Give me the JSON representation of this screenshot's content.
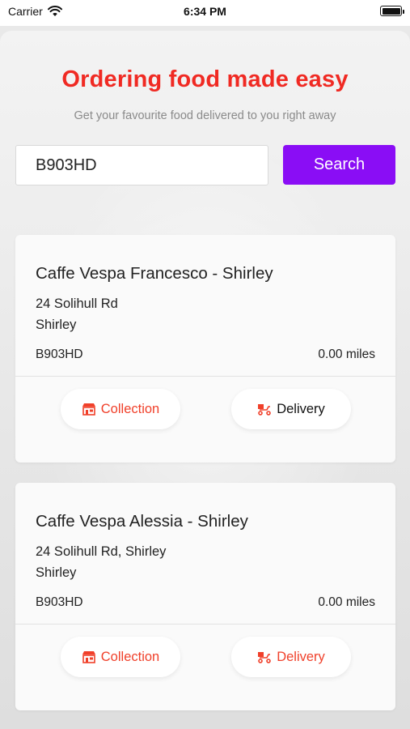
{
  "status_bar": {
    "carrier": "Carrier",
    "time": "6:34 PM"
  },
  "header": {
    "title": "Ordering food made easy",
    "subtitle": "Get your favourite food delivered to you right away"
  },
  "search": {
    "value": "B903HD",
    "button_label": "Search"
  },
  "restaurants": [
    {
      "name": "Caffe Vespa Francesco - Shirley",
      "address_line1": "24 Solihull Rd",
      "address_line2": "Shirley",
      "postcode": "B903HD",
      "distance": "0.00 miles",
      "collection_label": "Collection",
      "delivery_label": "Delivery"
    },
    {
      "name": "Caffe Vespa Alessia - Shirley",
      "address_line1": "24 Solihull Rd, Shirley",
      "address_line2": "Shirley",
      "postcode": "B903HD",
      "distance": "0.00 miles",
      "collection_label": "Collection",
      "delivery_label": "Delivery"
    }
  ],
  "colors": {
    "brand_red": "#f02a23",
    "search_button": "#8a0df5",
    "action_red": "#f0402a"
  },
  "icons": {
    "wifi": "wifi-icon",
    "battery": "battery-icon",
    "collection": "shop-icon",
    "delivery": "delivery-scooter-icon"
  }
}
